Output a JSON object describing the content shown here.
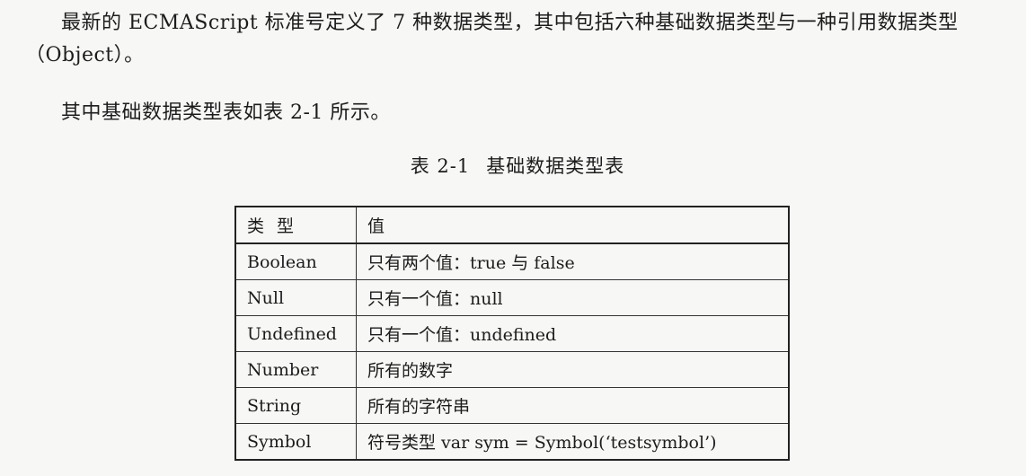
{
  "paragraphs": [
    "最新的 ECMAScript 标准号定义了 7 种数据类型，其中包括六种基础数据类型与一种引用数据类型（Object）。",
    "其中基础数据类型表如表 2-1 所示。"
  ],
  "caption": {
    "number": "表 2-1",
    "title": "基础数据类型表"
  },
  "table": {
    "headers": [
      "类型",
      "值"
    ],
    "rows": [
      [
        "Boolean",
        "只有两个值：true 与 false"
      ],
      [
        "Null",
        "只有一个值：null"
      ],
      [
        "Undefined",
        "只有一个值：undefined"
      ],
      [
        "Number",
        "所有的数字"
      ],
      [
        "String",
        "所有的字符串"
      ],
      [
        "Symbol",
        "符号类型 var sym = Symbol(‘testsymbol’)"
      ]
    ]
  }
}
